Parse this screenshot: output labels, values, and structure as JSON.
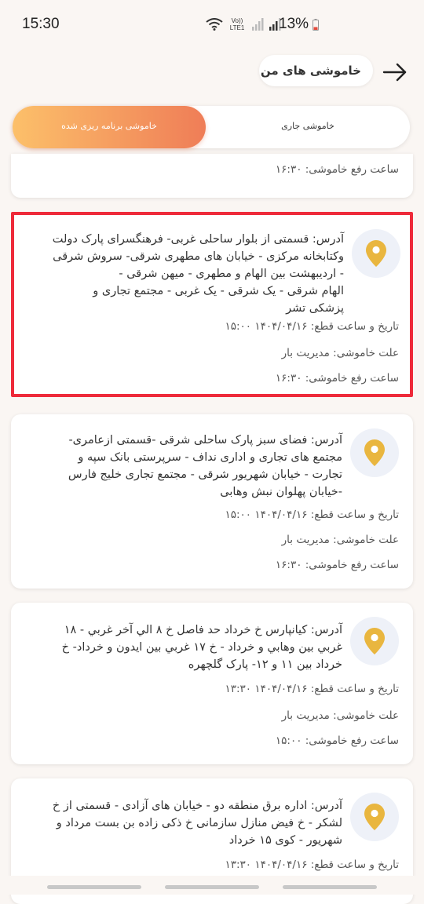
{
  "status_bar": {
    "time": "15:30",
    "volte": "Vo)) LTE1",
    "battery": "13%"
  },
  "header": {
    "title": "خاموشی های من",
    "back_icon": "arrow-right-icon"
  },
  "tabs": {
    "scheduled": "خاموشی برنامه ریزی شده",
    "current": "خاموشی جاری",
    "active_tab": "scheduled"
  },
  "partial_card": {
    "restore_line": "ساعت رفع خاموشی: ۱۶:۳۰"
  },
  "cards": [
    {
      "address_lines": [
        "آدرس: قسمتی از بلوار ساحلی غربی- فرهنگسرای پارک دولت",
        "وکتابخانه مرکزی - خیابان های مطهری شرقی- سروش شرقی",
        "- اردیبهشت بین الهام و مطهری -  میهن شرقی -",
        "الهام شرقی -  یک شرقی - یک غربی - مجتمع تجاری و",
        "پزشکی تشر"
      ],
      "outage_line": "تاریخ و ساعت قطع: ۱۴۰۴/۰۴/۱۶ ۱۵:۰۰",
      "reason_line": "علت خاموشی: مدیریت بار",
      "restore_line": "ساعت رفع خاموشی: ۱۶:۳۰"
    },
    {
      "address_lines": [
        "آدرس:  فضای سبز پارک ساحلی شرقی -قسمتی ازعامری-",
        "مجتمع های تجاری و اداری نداف - سرپرستی بانک سپه و",
        "تجارت - خیابان شهریور شرقی - مجتمع تجاری خلیج فارس",
        "-خیابان پهلوان نبش وهابی"
      ],
      "outage_line": "تاریخ و ساعت قطع: ۱۴۰۴/۰۴/۱۶ ۱۵:۰۰",
      "reason_line": "علت خاموشی: مدیریت بار",
      "restore_line": "ساعت رفع خاموشی: ۱۶:۳۰"
    },
    {
      "address_lines": [
        "آدرس:  کیانپارس خ خرداد حد فاصل خ ۸ الي آخر غربي - ۱۸",
        "غربي بين وهابي و خرداد - خ ۱۷ غربي بين ايدون و خرداد- خ",
        "خرداد بين ۱۱ و ۱۲-  پارک گلچهره"
      ],
      "outage_line": "تاریخ و ساعت قطع: ۱۴۰۴/۰۴/۱۶ ۱۳:۳۰",
      "reason_line": "علت خاموشی: مدیریت بار",
      "restore_line": "ساعت رفع خاموشی: ۱۵:۰۰"
    },
    {
      "address_lines": [
        "آدرس: اداره برق منطقه دو - خیابان های آزادی - قسمتی از خ",
        "لشکر - خ فیض منازل سازمانی خ ذکی زاده بن بست مرداد و",
        "شهریور - کوی ۱۵ خرداد"
      ],
      "outage_line": "تاریخ و ساعت قطع: ۱۴۰۴/۰۴/۱۶ ۱۳:۳۰"
    }
  ],
  "colors": {
    "accent_start": "#fcc06a",
    "accent_end": "#ef7d57",
    "pin": "#e9b63f",
    "highlight_border": "#ee2a3a"
  }
}
